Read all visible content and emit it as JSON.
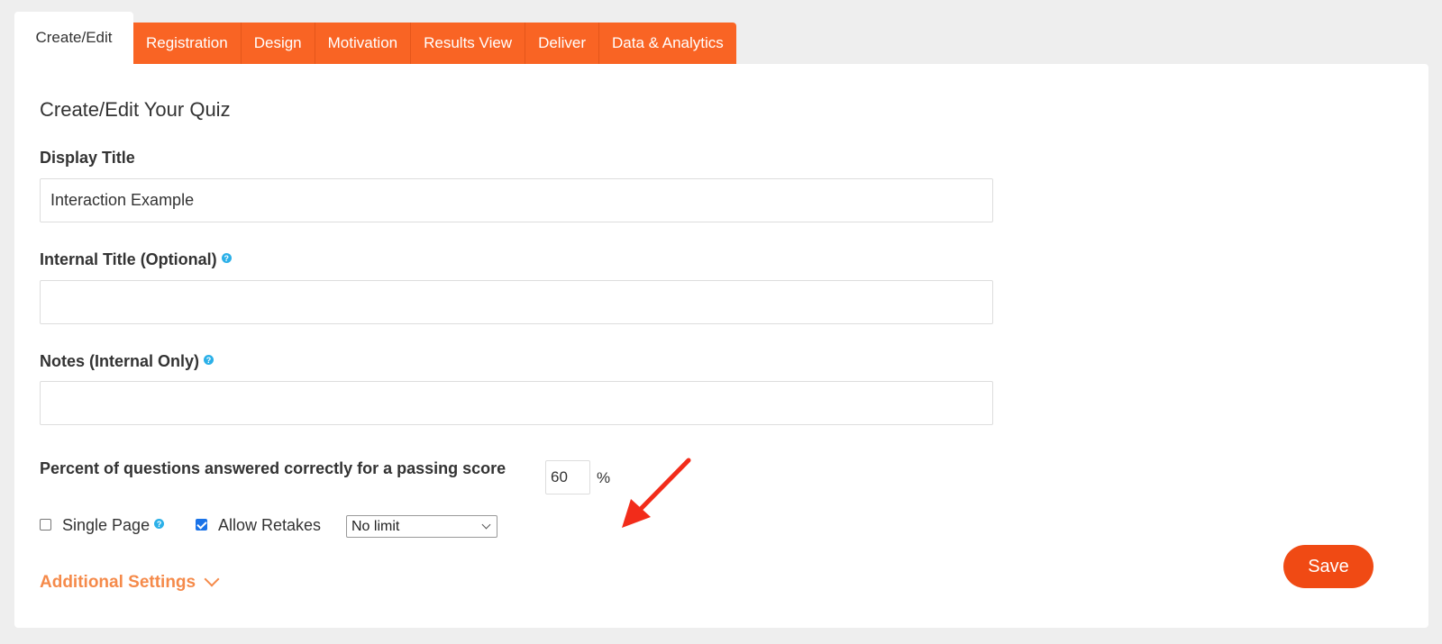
{
  "tabs": {
    "active": "Create/Edit",
    "items": [
      "Registration",
      "Design",
      "Motivation",
      "Results View",
      "Deliver",
      "Data & Analytics"
    ]
  },
  "page": {
    "title": "Create/Edit Your Quiz"
  },
  "fields": {
    "display_title": {
      "label": "Display Title",
      "value": "Interaction Example"
    },
    "internal_title": {
      "label": "Internal Title (Optional)",
      "value": ""
    },
    "notes": {
      "label": "Notes (Internal Only)",
      "value": ""
    },
    "passing_score": {
      "label": "Percent of questions answered correctly for a passing score",
      "value": "60",
      "unit": "%"
    }
  },
  "options": {
    "single_page": {
      "label": "Single Page",
      "checked": false
    },
    "allow_retakes": {
      "label": "Allow Retakes",
      "checked": true
    },
    "retake_limit": {
      "selected": "No limit"
    }
  },
  "additional_settings": {
    "label": "Additional Settings"
  },
  "actions": {
    "save_label": "Save"
  },
  "icons": {
    "help": "help-icon",
    "annotation": "red-arrow-icon",
    "expand": "chevron-down-icon"
  },
  "colors": {
    "tab_orange": "#f96424",
    "save_button": "#f04a14",
    "link_orange": "#f58a4a",
    "help_blue": "#2bb0e8",
    "checkbox_blue": "#1a73e8",
    "annotation_red": "#f22c1a"
  }
}
